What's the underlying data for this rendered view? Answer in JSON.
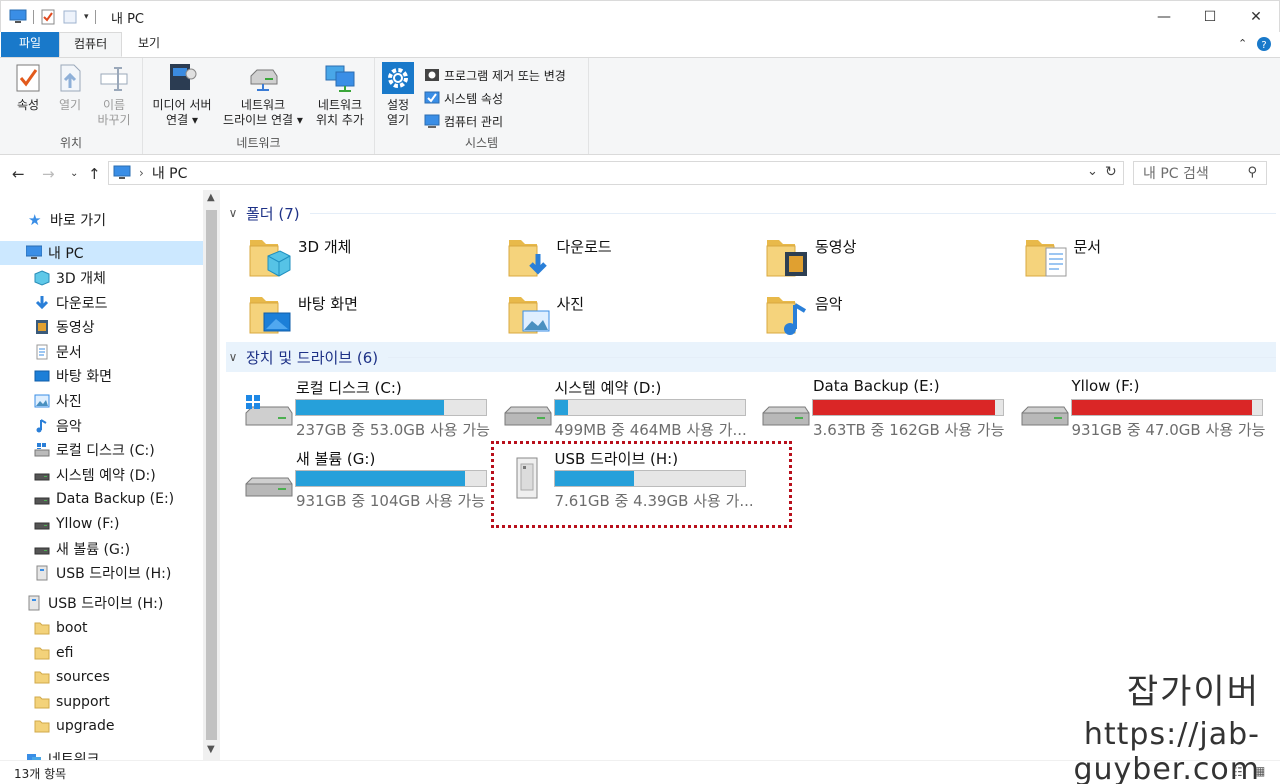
{
  "window": {
    "title": "내 PC"
  },
  "ribbon": {
    "tabs": [
      {
        "label": "파일"
      },
      {
        "label": "컴퓨터"
      },
      {
        "label": "보기"
      }
    ],
    "groups": {
      "location": {
        "label": "위치",
        "properties": "속성",
        "open": "열기",
        "rename_line1": "이름",
        "rename_line2": "바꾸기"
      },
      "network": {
        "label": "네트워크",
        "media_line1": "미디어 서버",
        "media_line2": "연결",
        "map_line1": "네트워크",
        "map_line2": "드라이브 연결",
        "add_line1": "네트워크",
        "add_line2": "위치 추가"
      },
      "system": {
        "label": "시스템",
        "settings_line1": "설정",
        "settings_line2": "열기",
        "uninstall": "프로그램 제거 또는 변경",
        "sys_props": "시스템 속성",
        "manage": "컴퓨터 관리"
      }
    }
  },
  "address": {
    "path": "내 PC",
    "search_placeholder": "내 PC 검색"
  },
  "nav": {
    "quick_access": "바로 가기",
    "this_pc": "내 PC",
    "pc_items": [
      "3D 개체",
      "다운로드",
      "동영상",
      "문서",
      "바탕 화면",
      "사진",
      "음악",
      "로컬 디스크 (C:)",
      "시스템 예약 (D:)",
      "Data Backup (E:)",
      "Yllow (F:)",
      "새 볼륨 (G:)",
      "USB 드라이브 (H:)"
    ],
    "usb": "USB 드라이브 (H:)",
    "usb_items": [
      "boot",
      "efi",
      "sources",
      "support",
      "upgrade"
    ],
    "network": "네트워크"
  },
  "folders": {
    "header": "폴더 (7)",
    "items": [
      "3D 개체",
      "다운로드",
      "동영상",
      "문서",
      "바탕 화면",
      "사진",
      "음악"
    ]
  },
  "drives": {
    "header": "장치 및 드라이브 (6)",
    "items": [
      {
        "name": "로컬 디스크 (C:)",
        "info": "237GB 중 53.0GB 사용 가능",
        "used_fraction": 0.78,
        "color": "#26a0da"
      },
      {
        "name": "시스템 예약 (D:)",
        "info": "499MB 중 464MB 사용 가...",
        "used_fraction": 0.07,
        "color": "#26a0da"
      },
      {
        "name": "Data Backup (E:)",
        "info": "3.63TB 중 162GB 사용 가능",
        "used_fraction": 0.96,
        "color": "#da2626"
      },
      {
        "name": "Yllow (F:)",
        "info": "931GB 중 47.0GB 사용 가능",
        "used_fraction": 0.95,
        "color": "#da2626"
      },
      {
        "name": "새 볼륨 (G:)",
        "info": "931GB 중 104GB 사용 가능",
        "used_fraction": 0.89,
        "color": "#26a0da"
      },
      {
        "name": "USB 드라이브 (H:)",
        "info": "7.61GB 중 4.39GB 사용 가...",
        "used_fraction": 0.42,
        "color": "#26a0da"
      }
    ]
  },
  "status": {
    "count": "13개 항목"
  },
  "watermark": {
    "line1": "잡가이버",
    "line2": "https://jab-guyber.com"
  }
}
